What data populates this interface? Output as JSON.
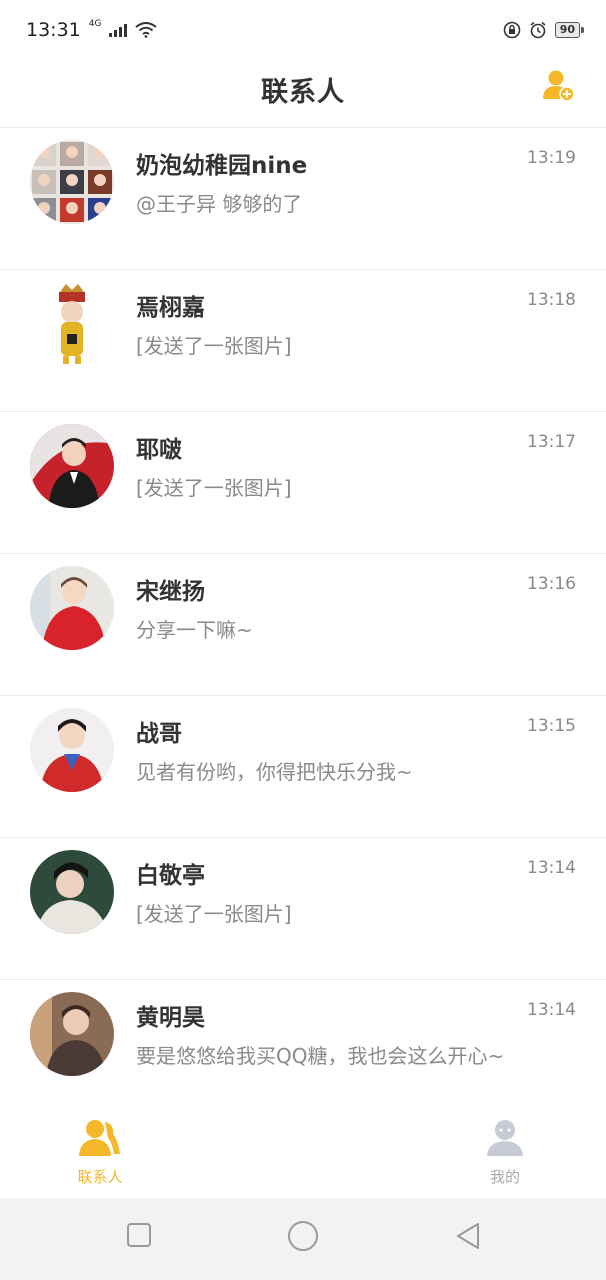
{
  "status_bar": {
    "time": "13:31",
    "network": "4G",
    "battery": "90",
    "icons": [
      "signal-icon",
      "wifi-icon",
      "lock-rotation-icon",
      "alarm-icon",
      "battery-icon"
    ]
  },
  "header": {
    "title": "联系人",
    "action_icon": "add-contact-icon"
  },
  "chats": [
    {
      "name": "奶泡幼稚园nine",
      "time": "13:19",
      "preview": "@王子异  够够的了"
    },
    {
      "name": "焉栩嘉",
      "time": "13:18",
      "preview": "[发送了一张图片]"
    },
    {
      "name": "耶啵",
      "time": "13:17",
      "preview": "[发送了一张图片]"
    },
    {
      "name": "宋继扬",
      "time": "13:16",
      "preview": "分享一下嘛~"
    },
    {
      "name": "战哥",
      "time": "13:15",
      "preview": "见者有份哟，你得把快乐分我~"
    },
    {
      "name": "白敬亭",
      "time": "13:14",
      "preview": "[发送了一张图片]"
    },
    {
      "name": "黄明昊",
      "time": "13:14",
      "preview": "要是悠悠给我买QQ糖，我也会这么开心~"
    }
  ],
  "tabbar": {
    "contacts_label": "联系人",
    "me_label": "我的"
  },
  "colors": {
    "accent": "#f5b82b",
    "inactive": "#a9a9a9"
  }
}
